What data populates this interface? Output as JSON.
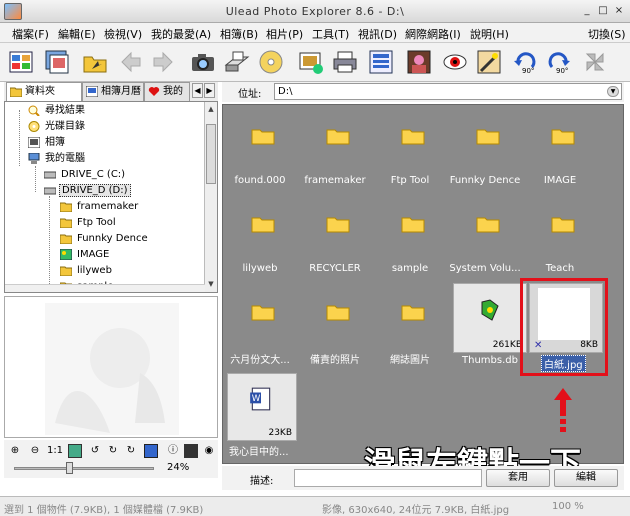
{
  "window": {
    "title": "Ulead Photo Explorer 8.6 - D:\\",
    "min": "_",
    "max": "□",
    "close": "×"
  },
  "menu": {
    "items": [
      "檔案(F)",
      "編輯(E)",
      "檢視(V)",
      "我的最愛(A)",
      "相簿(B)",
      "相片(P)",
      "工具(T)",
      "視訊(D)",
      "網際網路(I)",
      "說明(H)"
    ],
    "switch": "切換(S)"
  },
  "toolbar": {
    "buttons": [
      "thumbnails-icon",
      "browse-icon",
      "folder-up-icon",
      "back-icon",
      "forward-icon",
      "camera-icon",
      "scanner-icon",
      "cd-icon",
      "slideshow-icon",
      "print-icon",
      "view-icon",
      "photo-icon",
      "redeye-icon",
      "magic-wand-icon",
      "rotate-left-icon",
      "rotate-right-icon",
      "pinwheel-icon"
    ],
    "rotate_label": "90°"
  },
  "tree_tabs": {
    "folders": "資料夾",
    "albums": "相簿月曆",
    "favorites": "我的"
  },
  "tree": {
    "items": [
      "尋找結果",
      "光碟目錄",
      "相簿",
      "我的電腦",
      "DRIVE_C (C:)",
      "DRIVE_D (D:)",
      "framemaker",
      "Ftp Tool",
      "Funnky Dence",
      "IMAGE",
      "lilyweb",
      "sample"
    ]
  },
  "preview_controls": {
    "zoom_value": "24%",
    "ratio": "1:1"
  },
  "address": {
    "label": "位址:",
    "value": "D:\\"
  },
  "files": {
    "items": [
      "found.000",
      "framemaker",
      "Ftp Tool",
      "Funnky Dence",
      "IMAGE",
      "lilyweb",
      "RECYCLER",
      "sample",
      "System Volu...",
      "Teach",
      "六月份文大...",
      "備責的照片",
      "網誌圖片",
      "Thumbs.db",
      "白紙.jpg",
      "我心目中的..."
    ],
    "sizes": {
      "thumbs": "261KB",
      "blank": "8KB",
      "doc": "23KB"
    }
  },
  "callout": {
    "text": "滑鼠左鍵點一下"
  },
  "description": {
    "label": "描述:",
    "apply": "套用",
    "edit": "編輯"
  },
  "status": {
    "left": "選到 1 個物件 (7.9KB), 1 個媒體檔 (7.9KB)",
    "middle": "影像, 630x640, 24位元 7.9KB, 白紙.jpg",
    "right": "100 %"
  }
}
